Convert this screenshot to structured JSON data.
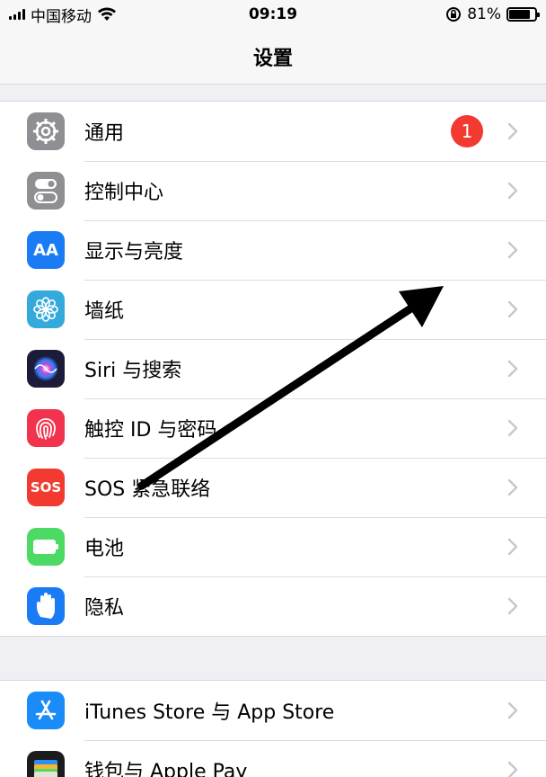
{
  "status": {
    "carrier": "中国移动",
    "time": "09:19",
    "battery_pct": "81%",
    "battery_level": 0.81
  },
  "nav": {
    "title": "设置"
  },
  "group1": [
    {
      "label": "通用",
      "icon": "gear-icon",
      "color": "#8e8e93",
      "badge": "1"
    },
    {
      "label": "控制中心",
      "icon": "toggles-icon",
      "color": "#8e8e93"
    },
    {
      "label": "显示与亮度",
      "icon": "text-size-icon",
      "color": "#1a7cf5",
      "icon_text": "AA"
    },
    {
      "label": "墙纸",
      "icon": "flower-icon",
      "color": "#34aadc"
    },
    {
      "label": "Siri 与搜索",
      "icon": "siri-icon",
      "color": "#1c1c3a"
    },
    {
      "label": "触控 ID 与密码",
      "icon": "fingerprint-icon",
      "color": "#f2334d"
    },
    {
      "label": "SOS 紧急联络",
      "icon": "sos-icon",
      "color": "#f23a30",
      "icon_text": "SOS"
    },
    {
      "label": "电池",
      "icon": "battery-icon",
      "color": "#4cd964"
    },
    {
      "label": "隐私",
      "icon": "hand-icon",
      "color": "#1a7cf5"
    }
  ],
  "group2": [
    {
      "label": "iTunes Store 与 App Store",
      "icon": "app-store-icon",
      "color": "#1a8cf7"
    },
    {
      "label": "钱包与 Apple Pay",
      "icon": "wallet-icon",
      "color": "#1c1c1e"
    }
  ]
}
